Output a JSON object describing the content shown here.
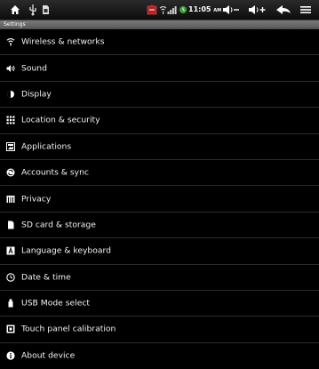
{
  "statusbar": {
    "time": "11:05",
    "ampm": "AM"
  },
  "header": {
    "title": "Settings"
  },
  "settings_items": [
    {
      "label": "Wireless & networks",
      "icon": "wifi-icon"
    },
    {
      "label": "Sound",
      "icon": "speaker-icon"
    },
    {
      "label": "Display",
      "icon": "brightness-icon"
    },
    {
      "label": "Location & security",
      "icon": "grid-icon"
    },
    {
      "label": "Applications",
      "icon": "applications-icon"
    },
    {
      "label": "Accounts & sync",
      "icon": "sync-icon"
    },
    {
      "label": "Privacy",
      "icon": "privacy-icon"
    },
    {
      "label": "SD card & storage",
      "icon": "sd-card-icon"
    },
    {
      "label": "Language & keyboard",
      "icon": "language-icon"
    },
    {
      "label": "Date & time",
      "icon": "clock-icon"
    },
    {
      "label": "USB Mode select",
      "icon": "usb-icon"
    },
    {
      "label": "Touch panel calibration",
      "icon": "touch-panel-icon"
    },
    {
      "label": "About device",
      "icon": "info-icon"
    }
  ]
}
